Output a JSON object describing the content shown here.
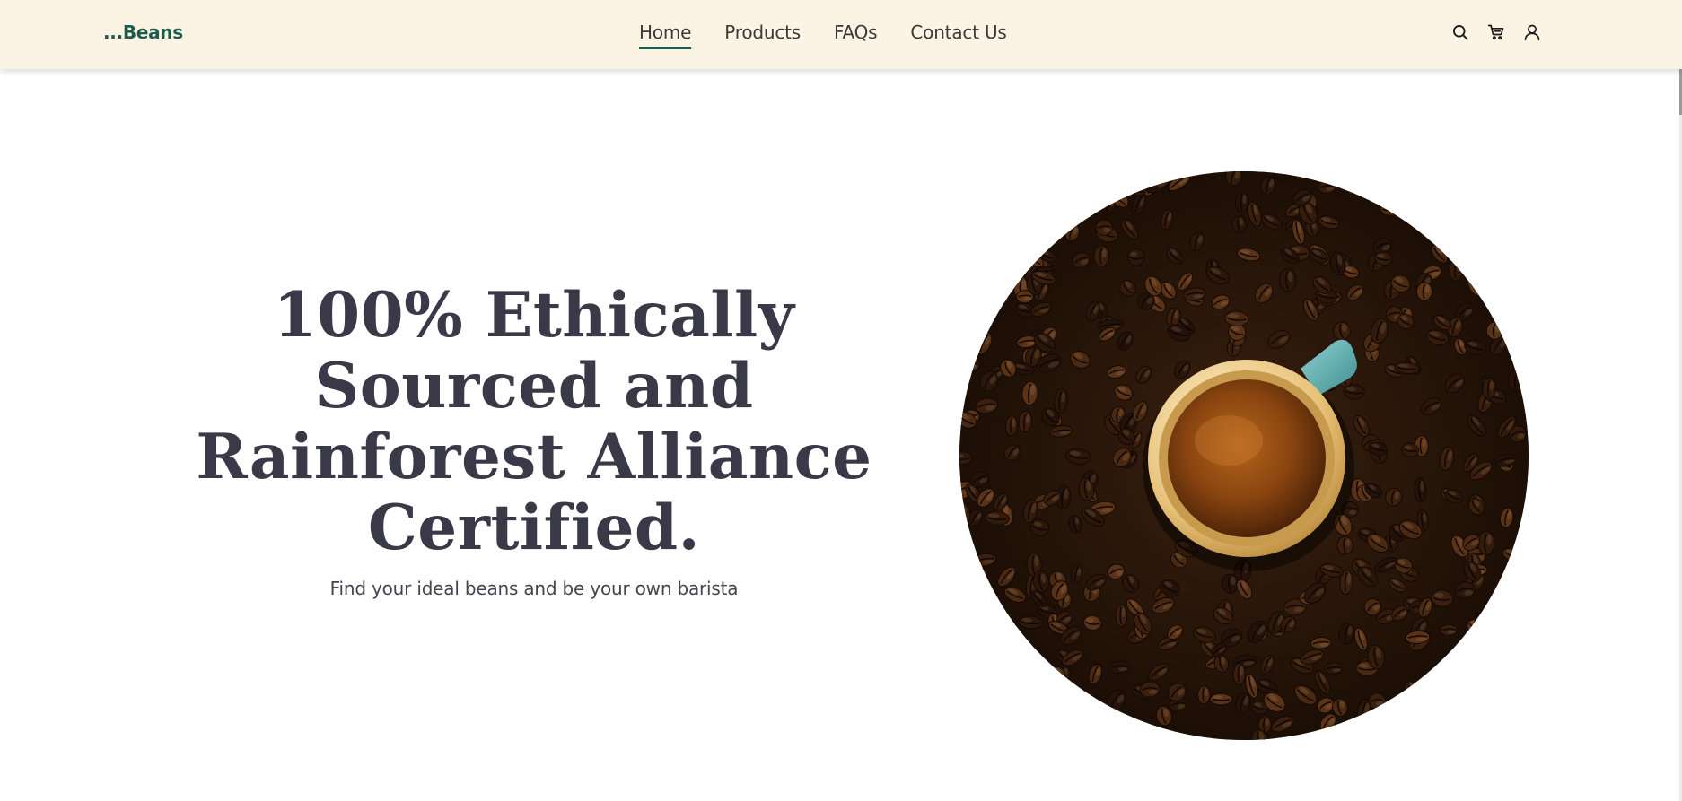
{
  "header": {
    "logo": "...Beans",
    "nav": [
      {
        "label": "Home",
        "active": true
      },
      {
        "label": "Products",
        "active": false
      },
      {
        "label": "FAQs",
        "active": false
      },
      {
        "label": "Contact Us",
        "active": false
      }
    ],
    "icons": [
      "search-icon",
      "cart-icon",
      "user-icon"
    ]
  },
  "hero": {
    "title": "100% Ethically Sourced and Rainforest Alliance Certified.",
    "subtitle": "Find your ideal beans and be your own barista",
    "image": "coffee cup on coffee beans"
  },
  "colors": {
    "header_bg": "#fbf3e4",
    "brand": "#1d5a4a",
    "title": "#393947",
    "text": "#3a3a3a"
  }
}
